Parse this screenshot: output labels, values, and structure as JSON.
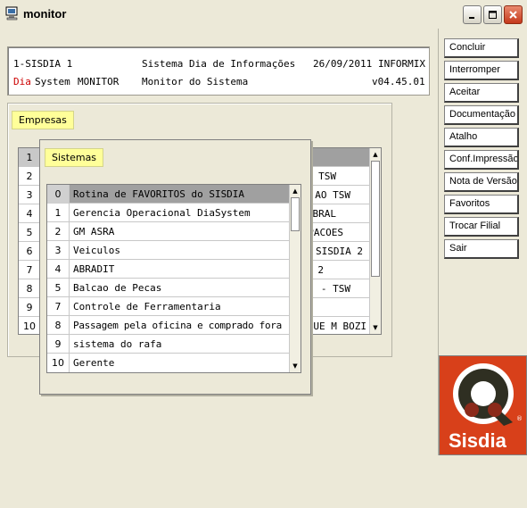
{
  "window": {
    "title": "monitor",
    "icons": {
      "app": "monitor-icon",
      "min": "minimize-icon",
      "max": "maximize-icon",
      "close": "close-icon"
    }
  },
  "header": {
    "line1": {
      "code": "1-SISDIA 1",
      "center": "Sistema Dia de Informações",
      "date": "26/09/2011",
      "db": "INFORMIX"
    },
    "line2": {
      "brand_dia": "Dia",
      "brand_system": "System",
      "module": "MONITOR",
      "center": "Monitor do Sistema",
      "version": "v04.45.01"
    }
  },
  "empresas": {
    "label": "Empresas",
    "rows": [
      {
        "num": "1",
        "value": ""
      },
      {
        "num": "2",
        "value": "TSW"
      },
      {
        "num": "3",
        "value": "AO TSW"
      },
      {
        "num": "4",
        "value": "BRAL"
      },
      {
        "num": "5",
        "value": "PACOES"
      },
      {
        "num": "6",
        "value": "SISDIA 2"
      },
      {
        "num": "7",
        "value": "2"
      },
      {
        "num": "8",
        "value": "- TSW"
      },
      {
        "num": "9",
        "value": ""
      },
      {
        "num": "10",
        "value": "QUE M BOZI"
      }
    ]
  },
  "sistemas": {
    "label": "Sistemas",
    "rows": [
      {
        "num": "0",
        "label": "Rotina de FAVORITOS do SISDIA"
      },
      {
        "num": "1",
        "label": "Gerencia Operacional DiaSystem"
      },
      {
        "num": "2",
        "label": "GM ASRA"
      },
      {
        "num": "3",
        "label": "Veiculos"
      },
      {
        "num": "4",
        "label": "ABRADIT"
      },
      {
        "num": "5",
        "label": "Balcao de Pecas"
      },
      {
        "num": "7",
        "label": "Controle de Ferramentaria"
      },
      {
        "num": "8",
        "label": "Passagem pela oficina e comprado fora"
      },
      {
        "num": "9",
        "label": "sistema do rafa"
      },
      {
        "num": "10",
        "label": "Gerente"
      }
    ]
  },
  "buttons": [
    "Concluir",
    "Interromper",
    "Aceitar",
    "Documentação",
    "Atalho",
    "Conf.Impressão",
    "Nota de Versão",
    "Favoritos",
    "Trocar Filial",
    "Sair"
  ],
  "logo": {
    "text": "Sisdia",
    "mark": "®"
  },
  "colors": {
    "accent_red": "#cc0000",
    "selection": "#a0a0a0",
    "tag_yellow": "#ffff99",
    "logo_bg": "#d8401a"
  }
}
